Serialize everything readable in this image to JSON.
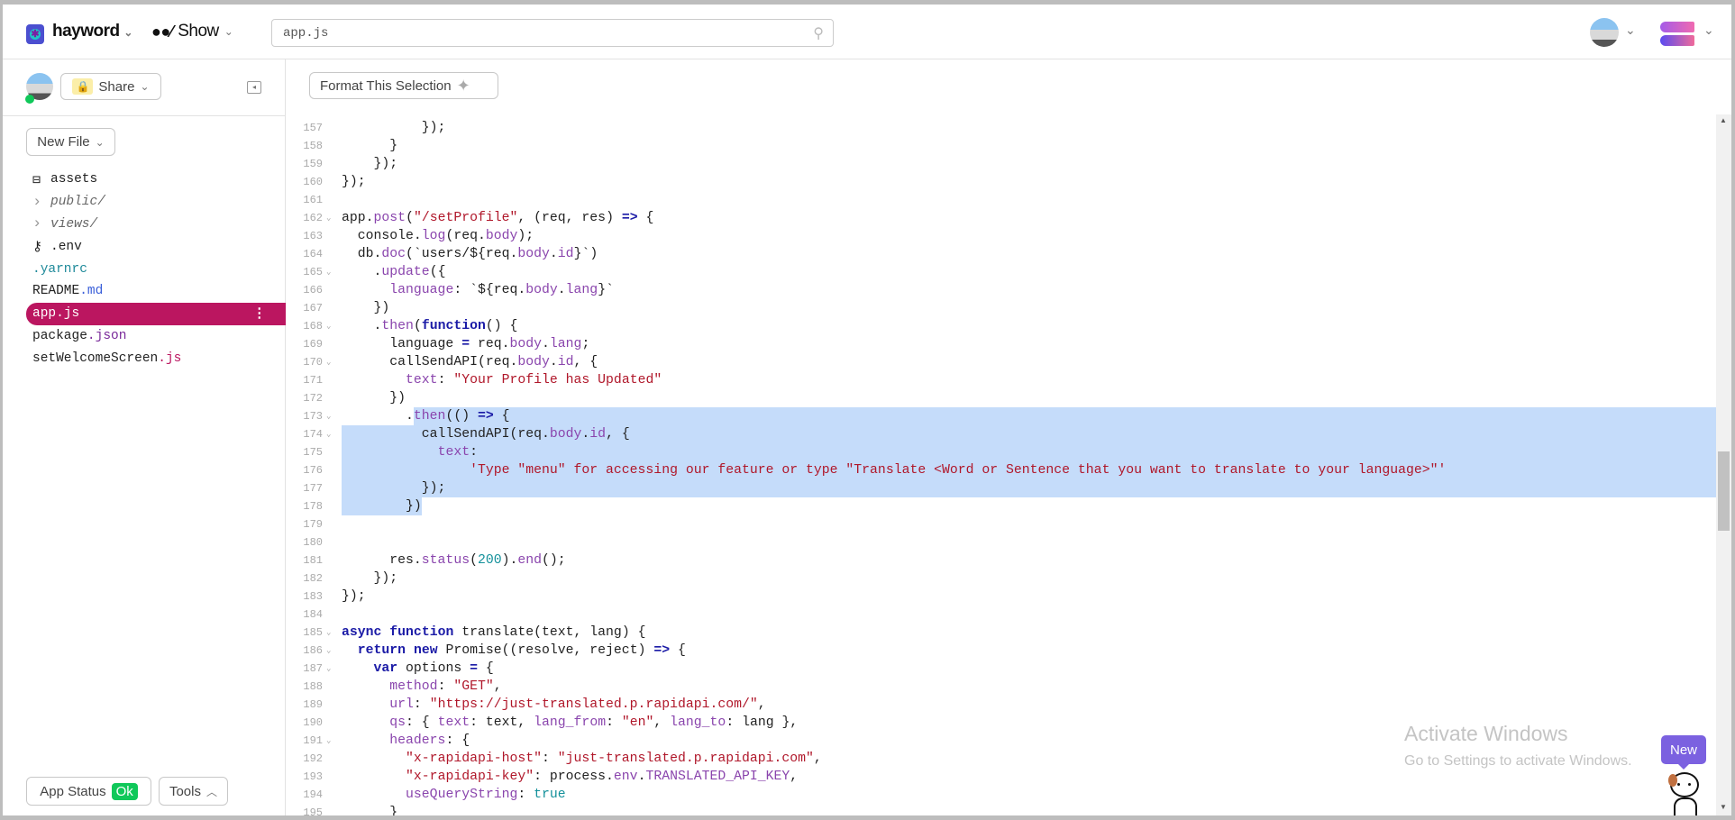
{
  "header": {
    "project": "hayword",
    "show_label": "Show",
    "search_value": "app.js"
  },
  "sidebar": {
    "share_label": "Share",
    "new_file_label": "New File",
    "files": [
      {
        "name": "assets",
        "ext": "",
        "icon": "archive-icon",
        "color": "#222"
      },
      {
        "name": "public/",
        "ext": "",
        "icon": "chevron-right-icon",
        "color": "#666",
        "italic": true
      },
      {
        "name": "views/",
        "ext": "",
        "icon": "chevron-right-icon",
        "color": "#666",
        "italic": true
      },
      {
        "name": ".env",
        "ext": "",
        "icon": "key-icon",
        "color": "#222"
      },
      {
        "name": ".yarnrc",
        "ext": "",
        "icon": "",
        "color": "#1f8a9a"
      },
      {
        "name": "README",
        "ext": ".md",
        "icon": "",
        "color": "#222",
        "ext_color": "#3a5fd9"
      },
      {
        "name": "app.js",
        "ext": "",
        "icon": "",
        "color": "#fff",
        "selected": true
      },
      {
        "name": "package",
        "ext": ".json",
        "icon": "",
        "color": "#222",
        "ext_color": "#7a2a9a"
      },
      {
        "name": "setWelcomeScreen",
        "ext": ".js",
        "icon": "",
        "color": "#222",
        "ext_color": "#bb1660"
      }
    ],
    "app_status_label": "App Status",
    "app_status_value": "Ok",
    "tools_label": "Tools"
  },
  "editor": {
    "format_label": "Format This Selection",
    "lines": [
      {
        "n": 157,
        "t": [
          [
            "p",
            "          });"
          ]
        ]
      },
      {
        "n": 158,
        "t": [
          [
            "p",
            "      }"
          ]
        ]
      },
      {
        "n": 159,
        "t": [
          [
            "p",
            "    });"
          ]
        ]
      },
      {
        "n": 160,
        "t": [
          [
            "p",
            "});"
          ]
        ]
      },
      {
        "n": 161,
        "t": []
      },
      {
        "n": 162,
        "f": 1,
        "t": [
          [
            "p",
            "app."
          ],
          [
            "pr",
            "post"
          ],
          [
            "p",
            "("
          ],
          [
            "s",
            "\"/setProfile\""
          ],
          [
            "p",
            ", (req, res) "
          ],
          [
            "b",
            "=>"
          ],
          [
            "p",
            " {"
          ]
        ]
      },
      {
        "n": 163,
        "t": [
          [
            "p",
            "  console."
          ],
          [
            "pr",
            "log"
          ],
          [
            "p",
            "(req."
          ],
          [
            "pr",
            "body"
          ],
          [
            "p",
            ");"
          ]
        ]
      },
      {
        "n": 164,
        "t": [
          [
            "p",
            "  db."
          ],
          [
            "pr",
            "doc"
          ],
          [
            "p",
            "(`users/${req."
          ],
          [
            "pr",
            "body"
          ],
          [
            "p",
            "."
          ],
          [
            "pr",
            "id"
          ],
          [
            "p",
            "}`)"
          ]
        ]
      },
      {
        "n": 165,
        "f": 1,
        "t": [
          [
            "p",
            "    ."
          ],
          [
            "pr",
            "update"
          ],
          [
            "p",
            "({"
          ]
        ]
      },
      {
        "n": 166,
        "t": [
          [
            "p",
            "      "
          ],
          [
            "pr",
            "language"
          ],
          [
            "p",
            ": `${req."
          ],
          [
            "pr",
            "body"
          ],
          [
            "p",
            "."
          ],
          [
            "pr",
            "lang"
          ],
          [
            "p",
            "}`"
          ]
        ]
      },
      {
        "n": 167,
        "t": [
          [
            "p",
            "    })"
          ]
        ]
      },
      {
        "n": 168,
        "f": 1,
        "t": [
          [
            "p",
            "    ."
          ],
          [
            "pr",
            "then"
          ],
          [
            "p",
            "("
          ],
          [
            "k",
            "function"
          ],
          [
            "p",
            "() {"
          ]
        ]
      },
      {
        "n": 169,
        "t": [
          [
            "p",
            "      language "
          ],
          [
            "b",
            "="
          ],
          [
            "p",
            " req."
          ],
          [
            "pr",
            "body"
          ],
          [
            "p",
            "."
          ],
          [
            "pr",
            "lang"
          ],
          [
            "p",
            ";"
          ]
        ]
      },
      {
        "n": 170,
        "f": 1,
        "t": [
          [
            "p",
            "      callSendAPI(req."
          ],
          [
            "pr",
            "body"
          ],
          [
            "p",
            "."
          ],
          [
            "pr",
            "id"
          ],
          [
            "p",
            ", {"
          ]
        ]
      },
      {
        "n": 171,
        "t": [
          [
            "p",
            "        "
          ],
          [
            "pr",
            "text"
          ],
          [
            "p",
            ": "
          ],
          [
            "s",
            "\"Your Profile has Updated\""
          ]
        ]
      },
      {
        "n": 172,
        "t": [
          [
            "p",
            "      })"
          ]
        ]
      },
      {
        "n": 173,
        "f": 1,
        "t": [
          [
            "p",
            "        ."
          ],
          [
            "pr",
            "then"
          ],
          [
            "p",
            "(() "
          ],
          [
            "b",
            "=>"
          ],
          [
            "p",
            " {"
          ]
        ]
      },
      {
        "n": 174,
        "f": 1,
        "t": [
          [
            "p",
            "          callSendAPI(req."
          ],
          [
            "pr",
            "body"
          ],
          [
            "p",
            "."
          ],
          [
            "pr",
            "id"
          ],
          [
            "p",
            ", {"
          ]
        ]
      },
      {
        "n": 175,
        "t": [
          [
            "p",
            "            "
          ],
          [
            "pr",
            "text"
          ],
          [
            "p",
            ":"
          ]
        ]
      },
      {
        "n": 176,
        "t": [
          [
            "p",
            "                "
          ],
          [
            "s",
            "'Type \"menu\" for accessing our feature or type \"Translate <Word or Sentence that you want to translate to your language>\"'"
          ]
        ]
      },
      {
        "n": 177,
        "t": [
          [
            "p",
            "          });"
          ]
        ]
      },
      {
        "n": 178,
        "t": [
          [
            "p",
            "        })"
          ]
        ]
      },
      {
        "n": 179,
        "t": []
      },
      {
        "n": 180,
        "t": []
      },
      {
        "n": 181,
        "t": [
          [
            "p",
            "      res."
          ],
          [
            "pr",
            "status"
          ],
          [
            "p",
            "("
          ],
          [
            "n",
            "200"
          ],
          [
            "p",
            ")."
          ],
          [
            "pr",
            "end"
          ],
          [
            "p",
            "();"
          ]
        ]
      },
      {
        "n": 182,
        "t": [
          [
            "p",
            "    });"
          ]
        ]
      },
      {
        "n": 183,
        "t": [
          [
            "p",
            "});"
          ]
        ]
      },
      {
        "n": 184,
        "t": []
      },
      {
        "n": 185,
        "f": 1,
        "t": [
          [
            "k",
            "async"
          ],
          [
            "p",
            " "
          ],
          [
            "k",
            "function"
          ],
          [
            "p",
            " translate(text, lang) {"
          ]
        ]
      },
      {
        "n": 186,
        "f": 1,
        "t": [
          [
            "p",
            "  "
          ],
          [
            "k",
            "return"
          ],
          [
            "p",
            " "
          ],
          [
            "k",
            "new"
          ],
          [
            "p",
            " Promise((resolve, reject) "
          ],
          [
            "b",
            "=>"
          ],
          [
            "p",
            " {"
          ]
        ]
      },
      {
        "n": 187,
        "f": 1,
        "t": [
          [
            "p",
            "    "
          ],
          [
            "k",
            "var"
          ],
          [
            "p",
            " options "
          ],
          [
            "b",
            "="
          ],
          [
            "p",
            " {"
          ]
        ]
      },
      {
        "n": 188,
        "t": [
          [
            "p",
            "      "
          ],
          [
            "pr",
            "method"
          ],
          [
            "p",
            ": "
          ],
          [
            "s",
            "\"GET\""
          ],
          [
            "p",
            ","
          ]
        ]
      },
      {
        "n": 189,
        "t": [
          [
            "p",
            "      "
          ],
          [
            "pr",
            "url"
          ],
          [
            "p",
            ": "
          ],
          [
            "s",
            "\"https://just-translated.p.rapidapi.com/\""
          ],
          [
            "p",
            ","
          ]
        ]
      },
      {
        "n": 190,
        "t": [
          [
            "p",
            "      "
          ],
          [
            "pr",
            "qs"
          ],
          [
            "p",
            ": { "
          ],
          [
            "pr",
            "text"
          ],
          [
            "p",
            ": text, "
          ],
          [
            "pr",
            "lang_from"
          ],
          [
            "p",
            ": "
          ],
          [
            "s",
            "\"en\""
          ],
          [
            "p",
            ", "
          ],
          [
            "pr",
            "lang_to"
          ],
          [
            "p",
            ": lang },"
          ]
        ]
      },
      {
        "n": 191,
        "f": 1,
        "t": [
          [
            "p",
            "      "
          ],
          [
            "pr",
            "headers"
          ],
          [
            "p",
            ": {"
          ]
        ]
      },
      {
        "n": 192,
        "t": [
          [
            "p",
            "        "
          ],
          [
            "s",
            "\"x-rapidapi-host\""
          ],
          [
            "p",
            ": "
          ],
          [
            "s",
            "\"just-translated.p.rapidapi.com\""
          ],
          [
            "p",
            ","
          ]
        ]
      },
      {
        "n": 193,
        "t": [
          [
            "p",
            "        "
          ],
          [
            "s",
            "\"x-rapidapi-key\""
          ],
          [
            "p",
            ": process."
          ],
          [
            "pr",
            "env"
          ],
          [
            "p",
            "."
          ],
          [
            "pr",
            "TRANSLATED_API_KEY"
          ],
          [
            "p",
            ","
          ]
        ]
      },
      {
        "n": 194,
        "t": [
          [
            "p",
            "        "
          ],
          [
            "pr",
            "useQueryString"
          ],
          [
            "p",
            ": "
          ],
          [
            "n",
            "true"
          ]
        ]
      },
      {
        "n": 195,
        "t": [
          [
            "p",
            "      }"
          ]
        ]
      }
    ]
  },
  "watermark": {
    "title": "Activate Windows",
    "subtitle": "Go to Settings to activate Windows."
  },
  "new_badge": "New",
  "colors": {
    "selected_file": "#bb1660",
    "selection": "#c5dcfa",
    "status_ok": "#10c85a",
    "new_badge": "#7b61e0"
  }
}
